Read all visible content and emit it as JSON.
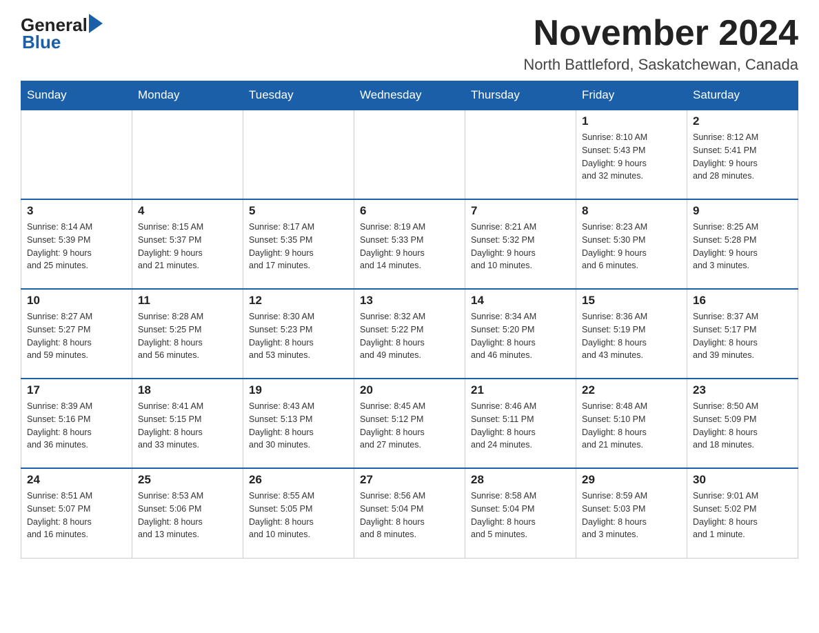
{
  "header": {
    "month_title": "November 2024",
    "location": "North Battleford, Saskatchewan, Canada",
    "logo_general": "General",
    "logo_blue": "Blue"
  },
  "calendar": {
    "days_of_week": [
      "Sunday",
      "Monday",
      "Tuesday",
      "Wednesday",
      "Thursday",
      "Friday",
      "Saturday"
    ],
    "weeks": [
      [
        {
          "day": "",
          "info": ""
        },
        {
          "day": "",
          "info": ""
        },
        {
          "day": "",
          "info": ""
        },
        {
          "day": "",
          "info": ""
        },
        {
          "day": "",
          "info": ""
        },
        {
          "day": "1",
          "info": "Sunrise: 8:10 AM\nSunset: 5:43 PM\nDaylight: 9 hours\nand 32 minutes."
        },
        {
          "day": "2",
          "info": "Sunrise: 8:12 AM\nSunset: 5:41 PM\nDaylight: 9 hours\nand 28 minutes."
        }
      ],
      [
        {
          "day": "3",
          "info": "Sunrise: 8:14 AM\nSunset: 5:39 PM\nDaylight: 9 hours\nand 25 minutes."
        },
        {
          "day": "4",
          "info": "Sunrise: 8:15 AM\nSunset: 5:37 PM\nDaylight: 9 hours\nand 21 minutes."
        },
        {
          "day": "5",
          "info": "Sunrise: 8:17 AM\nSunset: 5:35 PM\nDaylight: 9 hours\nand 17 minutes."
        },
        {
          "day": "6",
          "info": "Sunrise: 8:19 AM\nSunset: 5:33 PM\nDaylight: 9 hours\nand 14 minutes."
        },
        {
          "day": "7",
          "info": "Sunrise: 8:21 AM\nSunset: 5:32 PM\nDaylight: 9 hours\nand 10 minutes."
        },
        {
          "day": "8",
          "info": "Sunrise: 8:23 AM\nSunset: 5:30 PM\nDaylight: 9 hours\nand 6 minutes."
        },
        {
          "day": "9",
          "info": "Sunrise: 8:25 AM\nSunset: 5:28 PM\nDaylight: 9 hours\nand 3 minutes."
        }
      ],
      [
        {
          "day": "10",
          "info": "Sunrise: 8:27 AM\nSunset: 5:27 PM\nDaylight: 8 hours\nand 59 minutes."
        },
        {
          "day": "11",
          "info": "Sunrise: 8:28 AM\nSunset: 5:25 PM\nDaylight: 8 hours\nand 56 minutes."
        },
        {
          "day": "12",
          "info": "Sunrise: 8:30 AM\nSunset: 5:23 PM\nDaylight: 8 hours\nand 53 minutes."
        },
        {
          "day": "13",
          "info": "Sunrise: 8:32 AM\nSunset: 5:22 PM\nDaylight: 8 hours\nand 49 minutes."
        },
        {
          "day": "14",
          "info": "Sunrise: 8:34 AM\nSunset: 5:20 PM\nDaylight: 8 hours\nand 46 minutes."
        },
        {
          "day": "15",
          "info": "Sunrise: 8:36 AM\nSunset: 5:19 PM\nDaylight: 8 hours\nand 43 minutes."
        },
        {
          "day": "16",
          "info": "Sunrise: 8:37 AM\nSunset: 5:17 PM\nDaylight: 8 hours\nand 39 minutes."
        }
      ],
      [
        {
          "day": "17",
          "info": "Sunrise: 8:39 AM\nSunset: 5:16 PM\nDaylight: 8 hours\nand 36 minutes."
        },
        {
          "day": "18",
          "info": "Sunrise: 8:41 AM\nSunset: 5:15 PM\nDaylight: 8 hours\nand 33 minutes."
        },
        {
          "day": "19",
          "info": "Sunrise: 8:43 AM\nSunset: 5:13 PM\nDaylight: 8 hours\nand 30 minutes."
        },
        {
          "day": "20",
          "info": "Sunrise: 8:45 AM\nSunset: 5:12 PM\nDaylight: 8 hours\nand 27 minutes."
        },
        {
          "day": "21",
          "info": "Sunrise: 8:46 AM\nSunset: 5:11 PM\nDaylight: 8 hours\nand 24 minutes."
        },
        {
          "day": "22",
          "info": "Sunrise: 8:48 AM\nSunset: 5:10 PM\nDaylight: 8 hours\nand 21 minutes."
        },
        {
          "day": "23",
          "info": "Sunrise: 8:50 AM\nSunset: 5:09 PM\nDaylight: 8 hours\nand 18 minutes."
        }
      ],
      [
        {
          "day": "24",
          "info": "Sunrise: 8:51 AM\nSunset: 5:07 PM\nDaylight: 8 hours\nand 16 minutes."
        },
        {
          "day": "25",
          "info": "Sunrise: 8:53 AM\nSunset: 5:06 PM\nDaylight: 8 hours\nand 13 minutes."
        },
        {
          "day": "26",
          "info": "Sunrise: 8:55 AM\nSunset: 5:05 PM\nDaylight: 8 hours\nand 10 minutes."
        },
        {
          "day": "27",
          "info": "Sunrise: 8:56 AM\nSunset: 5:04 PM\nDaylight: 8 hours\nand 8 minutes."
        },
        {
          "day": "28",
          "info": "Sunrise: 8:58 AM\nSunset: 5:04 PM\nDaylight: 8 hours\nand 5 minutes."
        },
        {
          "day": "29",
          "info": "Sunrise: 8:59 AM\nSunset: 5:03 PM\nDaylight: 8 hours\nand 3 minutes."
        },
        {
          "day": "30",
          "info": "Sunrise: 9:01 AM\nSunset: 5:02 PM\nDaylight: 8 hours\nand 1 minute."
        }
      ]
    ]
  }
}
